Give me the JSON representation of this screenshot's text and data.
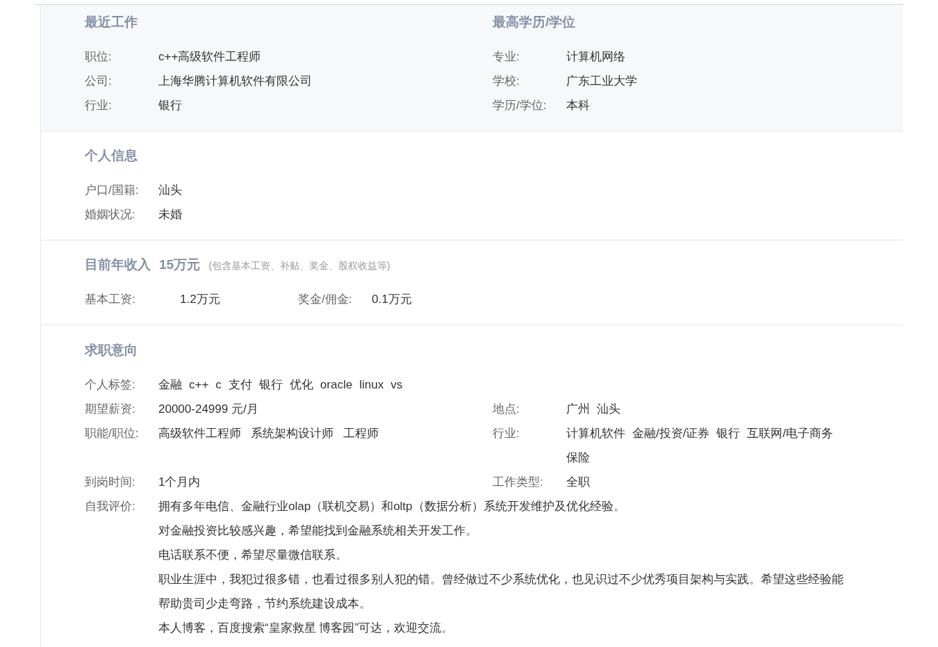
{
  "recent_work": {
    "title": "最近工作",
    "fields": [
      {
        "label": "职位:",
        "value": "c++高级软件工程师"
      },
      {
        "label": "公司:",
        "value": "上海华腾计算机软件有限公司"
      },
      {
        "label": "行业:",
        "value": "银行"
      }
    ]
  },
  "education": {
    "title": "最高学历/学位",
    "fields": [
      {
        "label": "专业:",
        "value": "计算机网络"
      },
      {
        "label": "学校:",
        "value": "广东工业大学"
      },
      {
        "label": "学历/学位:",
        "value": "本科"
      }
    ]
  },
  "personal": {
    "title": "个人信息",
    "fields": [
      {
        "label": "户口/国籍:",
        "value": "汕头"
      },
      {
        "label": "婚姻状况:",
        "value": "未婚"
      }
    ]
  },
  "income": {
    "title": "目前年收入",
    "amount": "15万元",
    "note": "(包含基本工资、补贴、奖金、股权收益等)",
    "fields": [
      {
        "label": "基本工资:",
        "value": "1.2万元"
      },
      {
        "label": "奖金/佣金:",
        "value": "0.1万元"
      }
    ]
  },
  "intention": {
    "title": "求职意向",
    "tags": {
      "label": "个人标签:",
      "items": [
        "金融",
        "c++",
        "c",
        "支付",
        "银行",
        "优化",
        "oracle",
        "linux",
        "vs"
      ]
    },
    "salary": {
      "label": "期望薪资:",
      "value": "20000-24999 元/月"
    },
    "location": {
      "label": "地点:",
      "items": [
        "广州",
        "汕头"
      ]
    },
    "positions": {
      "label": "职能/职位:",
      "items": [
        "高级软件工程师",
        "系统架构设计师",
        "工程师"
      ]
    },
    "industries": {
      "label": "行业:",
      "items": [
        "计算机软件",
        "金融/投资/证券",
        "银行",
        "互联网/电子商务",
        "保险"
      ]
    },
    "start": {
      "label": "到岗时间:",
      "value": "1个月内"
    },
    "job_type": {
      "label": "工作类型:",
      "value": "全职"
    },
    "self_eval": {
      "label": "自我评价:",
      "lines": [
        "拥有多年电信、金融行业olap（联机交易）和oltp（数据分析）系统开发维护及优化经验。",
        "对金融投资比较感兴趣，希望能找到金融系统相关开发工作。",
        "电话联系不便，希望尽量微信联系。",
        "职业生涯中，我犯过很多错，也看过很多别人犯的错。曾经做过不少系统优化，也见识过不少优秀项目架构与实践。希望这些经验能",
        "帮助贵司少走弯路，节约系统建设成本。",
        "本人博客，百度搜索“皇家救星 博客园”可达，欢迎交流。"
      ]
    }
  }
}
